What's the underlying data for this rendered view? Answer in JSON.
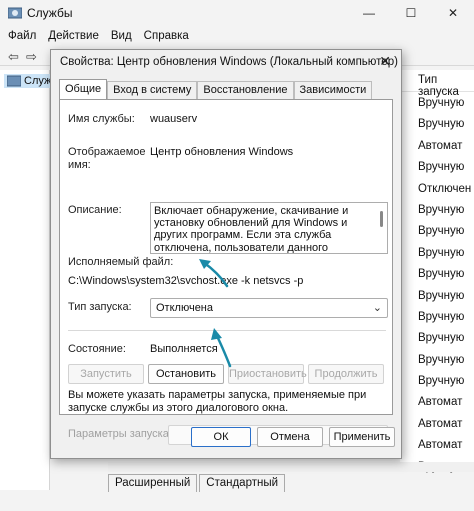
{
  "main": {
    "title": "Службы",
    "menu": [
      "Файл",
      "Действие",
      "Вид",
      "Справка"
    ],
    "tree_item": "Служ",
    "column_header": "Тип запуска",
    "startup_types": [
      "Вручную",
      "Вручную",
      "Автомат",
      "Вручную",
      "Отключен",
      "Вручную",
      "Вручную",
      "Вручную",
      "Вручную",
      "Вручную",
      "Вручную",
      "Вручную",
      "Вручную",
      "Вручную",
      "Автомат",
      "Автомат",
      "Автомат",
      "Вручную",
      "Автомат"
    ],
    "status_tabs": [
      "Расширенный",
      "Стандартный"
    ]
  },
  "dialog": {
    "title": "Свойства: Центр обновления Windows (Локальный компьютер)",
    "close_glyph": "✕",
    "tabs": [
      "Общие",
      "Вход в систему",
      "Восстановление",
      "Зависимости"
    ],
    "service_name_label": "Имя службы:",
    "service_name": "wuauserv",
    "display_name_label": "Отображаемое имя:",
    "display_name": "Центр обновления Windows",
    "description_label": "Описание:",
    "description": "Включает обнаружение, скачивание и установку обновлений для Windows и других программ. Если эта служба отключена, пользователи данного компьютера не смогут использовать",
    "exe_label": "Исполняемый файл:",
    "exe_path": "C:\\Windows\\system32\\svchost.exe -k netsvcs -p",
    "startup_label": "Тип запуска:",
    "startup_value": "Отключена",
    "state_label": "Состояние:",
    "state_value": "Выполняется",
    "buttons": {
      "start": "Запустить",
      "stop": "Остановить",
      "pause": "Приостановить",
      "resume": "Продолжить"
    },
    "note": "Вы можете указать параметры запуска, применяемые при запуске службы из этого диалогового окна.",
    "params_label": "Параметры запуска:",
    "params_value": "",
    "footer": {
      "ok": "ОК",
      "cancel": "Отмена",
      "apply": "Применить"
    }
  },
  "colors": {
    "accent": "#0067c0",
    "arrow": "#1a8aa8"
  },
  "icons": [
    "services-app-icon",
    "minimize-icon",
    "maximize-icon",
    "close-icon",
    "back-arrow-icon",
    "forward-arrow-icon",
    "chevron-down-icon"
  ]
}
